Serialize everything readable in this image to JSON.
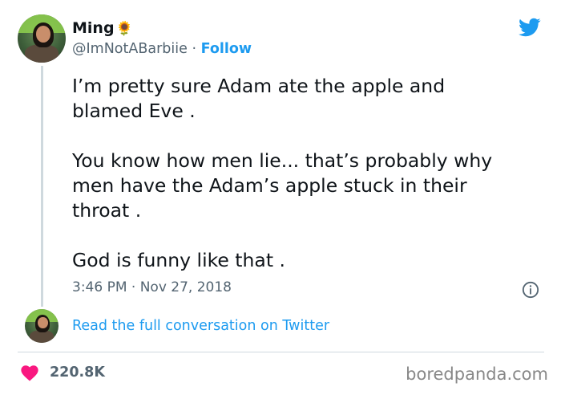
{
  "author": {
    "display_name": "Ming",
    "emoji": "🌻",
    "handle": "@ImNotABarbiie",
    "separator": " · ",
    "follow_label": "Follow"
  },
  "tweet": {
    "text": "I’m pretty sure Adam ate the apple and\nblamed Eve .\n\nYou know how men lie... that’s probably why\nmen have the Adam’s apple stuck in their\nthroat .\n\nGod is funny like that .",
    "timestamp": "3:46 PM · Nov 27, 2018"
  },
  "conversation_link": "Read the full conversation on Twitter",
  "engagement": {
    "likes": "220.8K"
  },
  "watermark": "boredpanda.com",
  "colors": {
    "accent": "#1d9bf0",
    "like": "#f91880",
    "muted": "#536471"
  }
}
